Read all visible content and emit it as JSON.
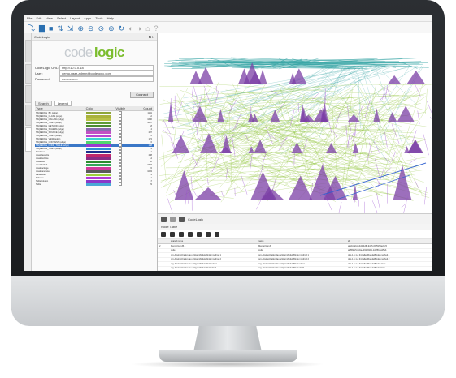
{
  "menu": [
    "File",
    "Edit",
    "View",
    "Select",
    "Layout",
    "Apps",
    "Tools",
    "Help"
  ],
  "codelogic_tab": "CodeLogic",
  "logo": {
    "part1": "code",
    "part2": "logic"
  },
  "connection": {
    "url_label": "CodeLogic URL:",
    "url_value": "http://10.0.0.18",
    "user_label": "User:",
    "user_value": "demo-user-admin@codelogic.com",
    "password_label": "Password:",
    "password_value": "••••••••••••••",
    "connect_label": "Connect"
  },
  "panel_tabs": [
    "Search",
    "Legend"
  ],
  "legend": {
    "columns": [
      "Type",
      "Color",
      "Visible",
      "Count"
    ],
    "rows": [
      {
        "name": "TSQLEDGE_BY (edge)",
        "color": "#8fa63a",
        "count": "1141"
      },
      {
        "name": "TSQLEDGE_CLASS (edge)",
        "color": "#a9b23c",
        "count": "12"
      },
      {
        "name": "TSQLEDGE_CALLING (edge)",
        "color": "#b8c045",
        "count": "1696"
      },
      {
        "name": "TSQLEDGE_TABLE (edge)",
        "color": "#5f9a36",
        "count": "3697"
      },
      {
        "name": "TSQLEDGE_METHOD (edge)",
        "color": "#4b8a2f",
        "count": "18"
      },
      {
        "name": "TSQLEDGE_SCHEMA (edge)",
        "color": "#8a6ab0",
        "count": "4"
      },
      {
        "name": "TSQLEDGE_SOURCE (edge)",
        "color": "#c24fc4",
        "count": "287"
      },
      {
        "name": "TSQLEDGE_TABLE (edge)",
        "color": "#b544d1",
        "count": "2"
      },
      {
        "name": "TSQLEDGE_VIEW (edge)",
        "color": "#3ad4d0",
        "count": "174"
      },
      {
        "name": "TSQLEDGE_CONTAINS (edge)",
        "color": "#4fd66e",
        "count": "6"
      },
      {
        "name": "TSQLEDGE_NODE_TABLE (edge)",
        "color": "#9b37d0",
        "count": "168"
      },
      {
        "name": "TSQLEDGE_TABLE (edge)",
        "color": "#2c8ed6",
        "count": "4"
      },
      {
        "name": "Database",
        "color": "#1a2f8c",
        "count": "1"
      },
      {
        "name": "JavaClassFile",
        "color": "#c0266c",
        "count": "208"
      },
      {
        "name": "JavaInterface",
        "color": "#8a2b86",
        "count": "14"
      },
      {
        "name": "JavaField",
        "color": "#2d8c2d",
        "count": "28"
      },
      {
        "name": "JavaMethod",
        "color": "#36a65a",
        "count": "1527"
      },
      {
        "name": "JavaPackage",
        "color": "#d13a9b",
        "count": "15"
      },
      {
        "name": "JavaParameter",
        "color": "#5a5a5a",
        "count": "1093"
      },
      {
        "name": "Parameter",
        "color": "#9ecf3d",
        "count": "4"
      },
      {
        "name": "Schema",
        "color": "#b23ad6",
        "count": "1"
      },
      {
        "name": "TableColumn",
        "color": "#8a38c9",
        "count": "17"
      },
      {
        "name": "Table",
        "color": "#4aa9d6",
        "count": "23"
      }
    ]
  },
  "graph_tool_label": "CodeLogic",
  "results": {
    "header": "Node Table",
    "columns": [
      "",
      "shared name",
      "name",
      "id"
    ],
    "rows": [
      {
        "c1": "2",
        "c2": "MergeQueryB...",
        "c3": "MergeQueryB",
        "c4": "a8c1ba0d-b4d2-4dfb-9da5-6f45979ad7c5"
      },
      {
        "c1": "",
        "c2": "code",
        "c3": "code",
        "c4": "a8f5bbc5-6d1a-4f41-b999-1d2f5b4a35ab"
      },
      {
        "c1": "",
        "c2": "org.AbstractCaller.dao.widget.ModuleBinder.method 1",
        "c3": "org.AbstractCaller.dao.widget.ModuleBinder.method 1",
        "c4": "dao.1.1.1.o.fmCaller.ModuleBinder.method.1"
      },
      {
        "c1": "",
        "c2": "org.AbstractCaller.dao.widget.ModuleBinder.method 2",
        "c3": "org.AbstractCaller.dao.widget.ModuleBinder.method 2",
        "c4": "dao.1.1.1.o.fmCaller.ModuleBinder.method.2"
      },
      {
        "c1": "",
        "c2": "org.AbstractCaller.dao.widget.ModuleBinder.class",
        "c3": "org.AbstractCaller.dao.widget.ModuleBinder.class",
        "c4": "dao.1.1.1.o.fmCaller.ModuleBinder.class"
      },
      {
        "c1": "",
        "c2": "org.AbstractCaller.dao.widget.ModuleBinder.field",
        "c3": "org.AbstractCaller.dao.widget.ModuleBinder.field",
        "c4": "dao.1.1.1.o.fmCaller.ModuleBinder.field"
      },
      {
        "c1": "",
        "c2": "org.AbstractCaller.dao.widget.ModuleBinderBase",
        "c3": "org.AbstractCaller.dao.widget.ModuleBinderBase",
        "c4": "dao.1.1.1.o.fmCaller.ModuleBinderBase"
      }
    ]
  }
}
